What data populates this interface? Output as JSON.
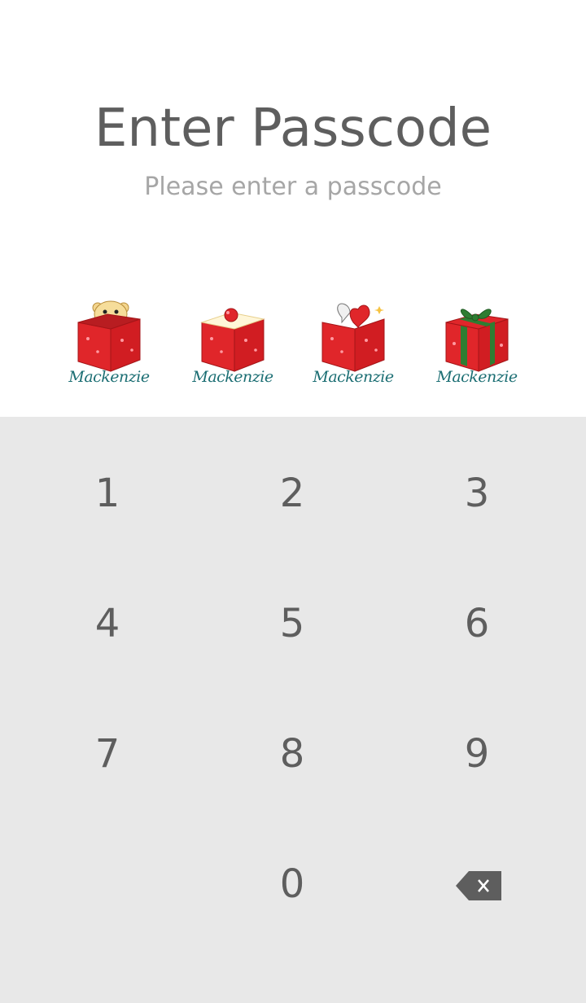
{
  "header": {
    "title": "Enter Passcode",
    "subtitle": "Please enter a passcode"
  },
  "passcode_slots": [
    {
      "icon": "teddy-bear-gift-box-icon",
      "label": "Mackenzie"
    },
    {
      "icon": "cake-gift-box-icon",
      "label": "Mackenzie"
    },
    {
      "icon": "heart-gift-box-icon",
      "label": "Mackenzie"
    },
    {
      "icon": "ribbon-gift-box-icon",
      "label": "Mackenzie"
    }
  ],
  "keypad": {
    "keys": [
      "1",
      "2",
      "3",
      "4",
      "5",
      "6",
      "7",
      "8",
      "9",
      "0"
    ],
    "backspace_icon": "backspace-icon"
  },
  "colors": {
    "keypad_background": "#e8e8e8",
    "text": "#5e5e5e",
    "subtitle": "#a6a6a6",
    "gift_red": "#e0262a",
    "label_teal": "#1b6e73"
  }
}
